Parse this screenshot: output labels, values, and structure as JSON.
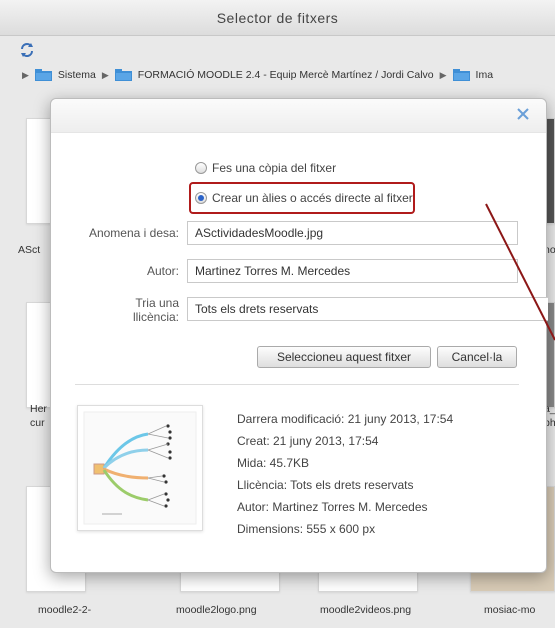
{
  "window": {
    "title": "Selector de fitxers"
  },
  "breadcrumb": {
    "items": [
      "Sistema",
      "FORMACIÓ MOODLE 2.4 - Equip Mercè Martínez / Jordi Calvo",
      "Ima"
    ]
  },
  "background": {
    "labels": {
      "left_top": "ASct",
      "right_top": "noo",
      "left_mid_1": "Her",
      "left_mid_2": "cur",
      "right_mid_1": "a_",
      "right_mid_2": "ph",
      "bottom": [
        "moodle2-2-",
        "moodle2logo.png",
        "moodle2videos.png",
        "mosiac-mo"
      ]
    }
  },
  "dialog": {
    "options": {
      "copy_label": "Fes una còpia del fitxer",
      "alias_label": "Crear un àlies o accés directe al fitxer",
      "selected": "alias"
    },
    "fields": {
      "save_as_label": "Anomena i desa:",
      "save_as_value": "ASctividadesMoodle.jpg",
      "author_label": "Autor:",
      "author_value": "Martinez Torres M. Mercedes",
      "license_label": "Tria una llicència:",
      "license_value": "Tots els drets reservats"
    },
    "buttons": {
      "select_label": "Seleccioneu aquest fitxer",
      "cancel_label": "Cancel·la"
    },
    "info": {
      "modified": "Darrera modificació: 21 juny 2013, 17:54",
      "created": "Creat: 21 juny 2013, 17:54",
      "size": "Mida: 45.7KB",
      "license": "Llicència: Tots els drets reservats",
      "author": "Autor: Martinez Torres M. Mercedes",
      "dimensions": "Dimensions: 555 x 600 px"
    }
  },
  "colors": {
    "highlight": "#b01b1b",
    "radio_selected": "#2b63c9",
    "close_icon": "#6a9fd8",
    "folder": "#3f8fd6"
  }
}
